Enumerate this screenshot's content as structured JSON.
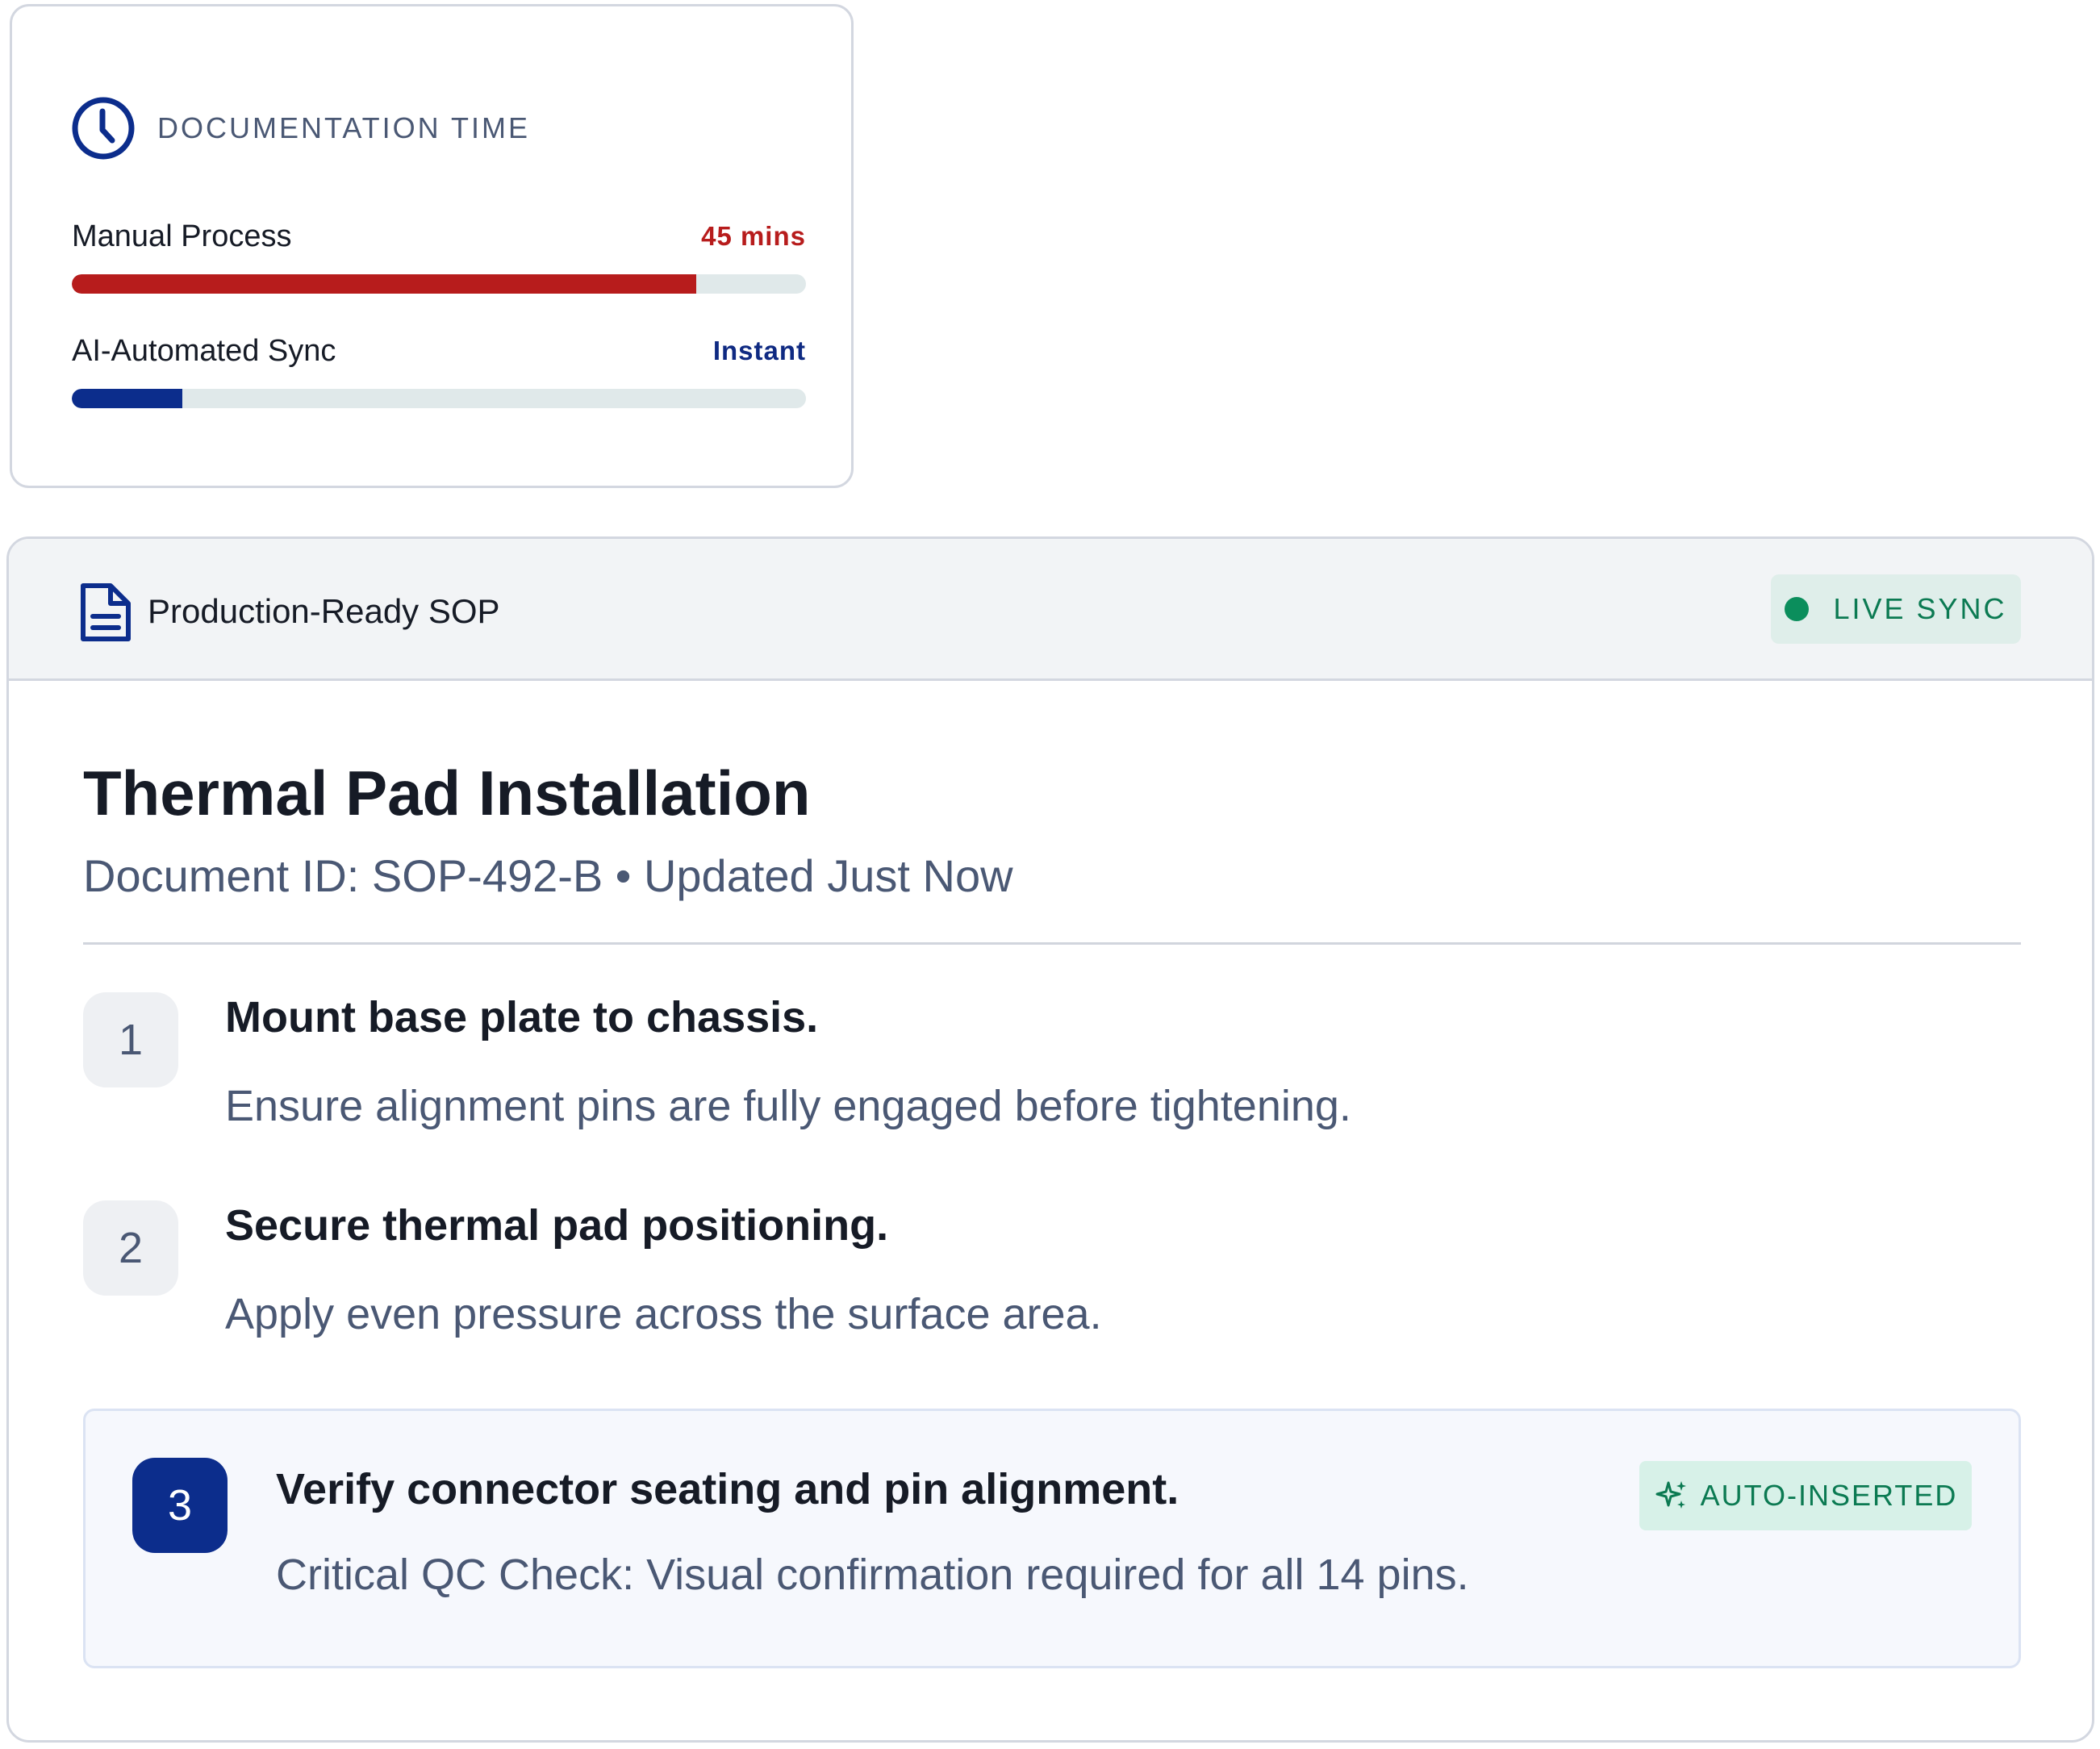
{
  "documentation_time": {
    "title": "DOCUMENTATION TIME",
    "icon": "clock-icon",
    "rows": [
      {
        "label": "Manual Process",
        "value": "45 mins",
        "fill_percent": 85,
        "color": "#b71c1c"
      },
      {
        "label": "AI-Automated Sync",
        "value": "Instant",
        "fill_percent": 15,
        "color": "#0c2d8c"
      }
    ]
  },
  "sop": {
    "header_title": "Production-Ready SOP",
    "header_icon": "document-icon",
    "live_badge": "LIVE SYNC",
    "live_color": "#0b8e5c",
    "title": "Thermal Pad Installation",
    "meta": "Document ID: SOP-492-B • Updated Just Now",
    "steps": [
      {
        "number": "1",
        "title": "Mount base plate to chassis.",
        "description": "Ensure alignment pins are fully engaged before tightening."
      },
      {
        "number": "2",
        "title": "Secure thermal pad positioning.",
        "description": "Apply even pressure across the surface area."
      },
      {
        "number": "3",
        "title": "Verify connector seating and pin alignment.",
        "description": "Critical QC Check: Visual confirmation required for all 14 pins.",
        "badge": "AUTO-INSERTED",
        "badge_icon": "sparkle-icon"
      }
    ]
  }
}
